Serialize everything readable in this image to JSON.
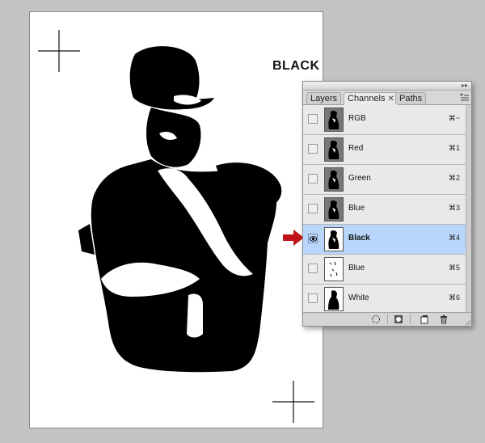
{
  "document": {
    "label": "BLACK"
  },
  "panel": {
    "tabs": [
      {
        "label": "Layers",
        "active": false
      },
      {
        "label": "Channels",
        "active": true,
        "close_glyph": "✕"
      },
      {
        "label": "Paths",
        "active": false
      }
    ],
    "collapse_glyph": "▸▸",
    "menu_icon": "panel-menu-icon",
    "channels": [
      {
        "name": "RGB",
        "shortcut": "⌘~",
        "visible": false,
        "selected": false,
        "thumb": "dark"
      },
      {
        "name": "Red",
        "shortcut": "⌘1",
        "visible": false,
        "selected": false,
        "thumb": "dark"
      },
      {
        "name": "Green",
        "shortcut": "⌘2",
        "visible": false,
        "selected": false,
        "thumb": "dark"
      },
      {
        "name": "Blue",
        "shortcut": "⌘3",
        "visible": false,
        "selected": false,
        "thumb": "dark"
      },
      {
        "name": "Black",
        "shortcut": "⌘4",
        "visible": true,
        "selected": true,
        "thumb": "light"
      },
      {
        "name": "Blue",
        "shortcut": "⌘5",
        "visible": false,
        "selected": false,
        "thumb": "sparse"
      },
      {
        "name": "White",
        "shortcut": "⌘6",
        "visible": false,
        "selected": false,
        "thumb": "silhouette"
      }
    ],
    "footer_icons": [
      "load-selection-icon",
      "save-selection-icon",
      "new-channel-icon",
      "trash-icon"
    ]
  },
  "colors": {
    "selected_row": "#b8d6fb",
    "arrow": "#c0151b",
    "canvas_bg": "#c3c3c3"
  }
}
